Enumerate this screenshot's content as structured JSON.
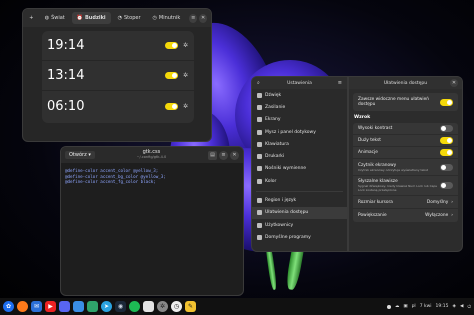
{
  "clock": {
    "tabs": [
      {
        "label": "Świat",
        "icon": "globe-icon"
      },
      {
        "label": "Budziki",
        "icon": "alarm-icon",
        "active": true
      },
      {
        "label": "Stoper",
        "icon": "stopwatch-icon"
      },
      {
        "label": "Minutnik",
        "icon": "timer-icon"
      }
    ],
    "alarms": [
      {
        "time": "19:14",
        "on": true
      },
      {
        "time": "13:14",
        "on": true
      },
      {
        "time": "06:10",
        "on": true
      }
    ]
  },
  "editor": {
    "open_label": "Otwórz",
    "title": "gtk.css",
    "subtitle": "~/.config/gtk-4.0",
    "lines": [
      "@define-color accent_color @yellow_3;",
      "@define-color accent_bg_color @yellow_3;",
      "@define-color accent_fg_color black;"
    ]
  },
  "settings": {
    "title": "Ustawienia",
    "items": [
      {
        "label": "Dźwięk",
        "icon": "speaker-icon"
      },
      {
        "label": "Zasilanie",
        "icon": "battery-icon"
      },
      {
        "label": "Ekrany",
        "icon": "display-icon"
      },
      {
        "label": "Mysz i panel dotykowy",
        "icon": "mouse-icon"
      },
      {
        "label": "Klawiatura",
        "icon": "keyboard-icon"
      },
      {
        "label": "Drukarki",
        "icon": "printer-icon"
      },
      {
        "label": "Nośniki wymienne",
        "icon": "media-icon"
      },
      {
        "label": "Kolor",
        "icon": "color-icon"
      },
      {
        "label": "Region i język",
        "icon": "region-icon"
      },
      {
        "label": "Ułatwienia dostępu",
        "icon": "accessibility-icon",
        "active": true
      },
      {
        "label": "Użytkownicy",
        "icon": "users-icon"
      },
      {
        "label": "Domyślne programy",
        "icon": "apps-icon"
      }
    ]
  },
  "a11y": {
    "title": "Ułatwienia dostępu",
    "always_show": "Zawsze widoczne menu ułatwień dostępu",
    "section": "Wzrok",
    "rows": [
      {
        "label": "Wysoki kontrast",
        "on": false
      },
      {
        "label": "Duży tekst",
        "on": true
      },
      {
        "label": "Animacje",
        "on": true
      },
      {
        "label": "Czytnik ekranowy",
        "sub": "Czytnik ekranowy odczytuje wyświetlany tekst",
        "on": false
      },
      {
        "label": "Słyszalne klawisze",
        "sub": "Sygnał dźwiękowy, kiedy klawisz Num Lock lub Caps Lock zostaną przełączone",
        "on": false
      }
    ],
    "cursor_label": "Rozmiar kursora",
    "cursor_value": "Domyślny",
    "zoom_label": "Powiększanie",
    "zoom_value": "Wyłączone"
  },
  "tray": {
    "lang": "pl",
    "date": "7 kwi",
    "time": "19:15"
  }
}
